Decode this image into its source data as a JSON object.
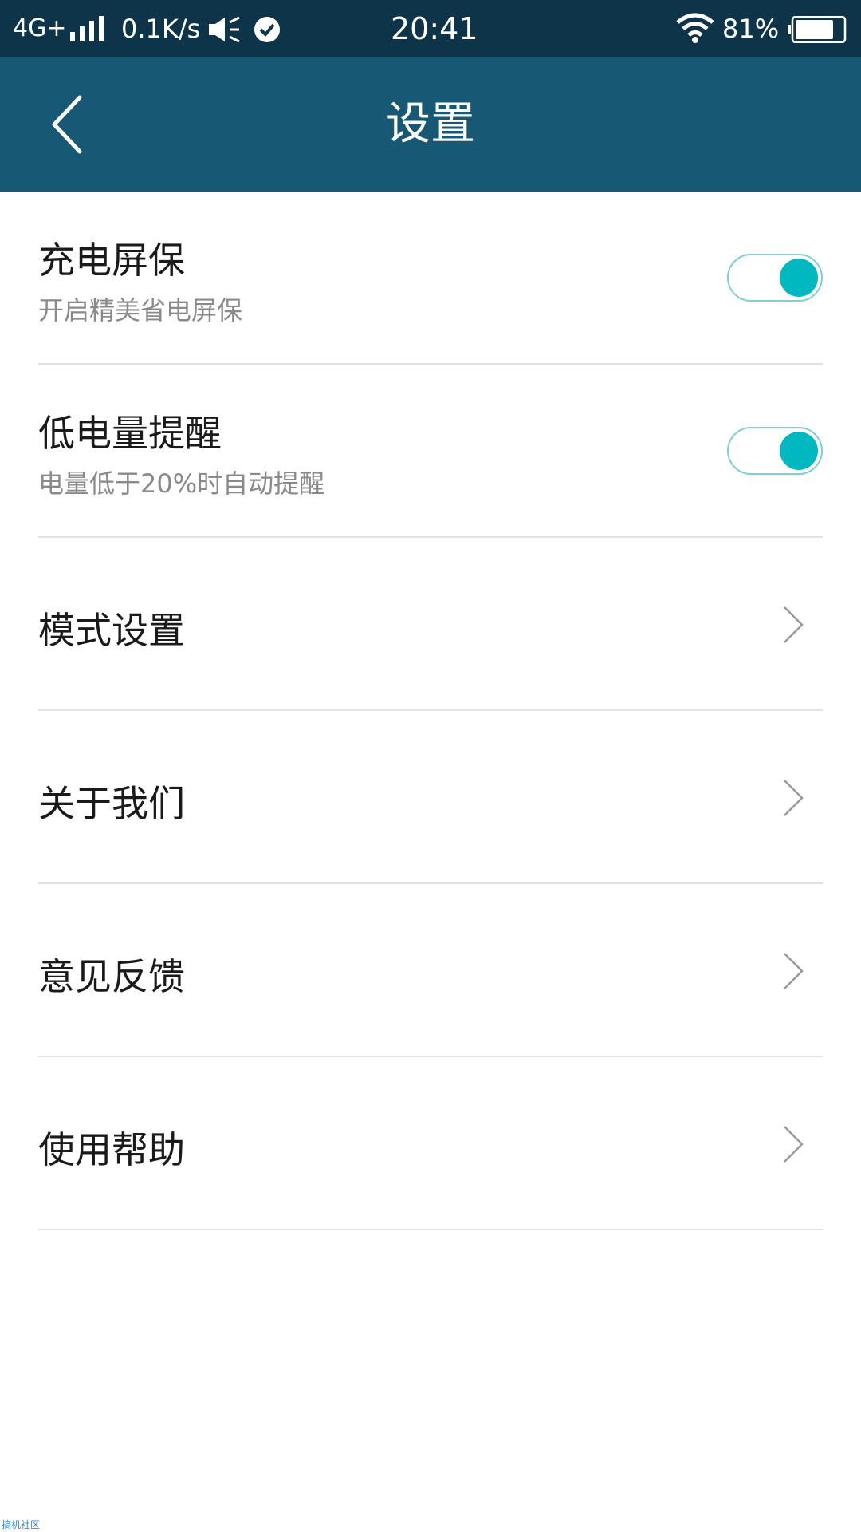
{
  "status_bar": {
    "network": "4G+",
    "speed": "0.1K/s",
    "time": "20:41",
    "battery_percent": "81%",
    "battery_level": 0.81,
    "icons": [
      "signal-icon",
      "vibrate-icon",
      "check-circle-icon",
      "wifi-icon",
      "battery-icon"
    ]
  },
  "header": {
    "title": "设置",
    "back_icon": "chevron-left-icon"
  },
  "settings": {
    "items": [
      {
        "title": "充电屏保",
        "subtitle": "开启精美省电屏保",
        "control": "toggle",
        "enabled": true
      },
      {
        "title": "低电量提醒",
        "subtitle": "电量低于20%时自动提醒",
        "control": "toggle",
        "enabled": true
      },
      {
        "title": "模式设置",
        "control": "chevron"
      },
      {
        "title": "关于我们",
        "control": "chevron"
      },
      {
        "title": "意见反馈",
        "control": "chevron"
      },
      {
        "title": "使用帮助",
        "control": "chevron"
      }
    ]
  },
  "watermark": "搞机社区",
  "colors": {
    "status_bar_bg": "#0d3448",
    "header_bg": "#175974",
    "toggle_accent": "#00b8c0",
    "divider": "#e2e2e2",
    "subtitle_text": "#8a8a8a"
  }
}
